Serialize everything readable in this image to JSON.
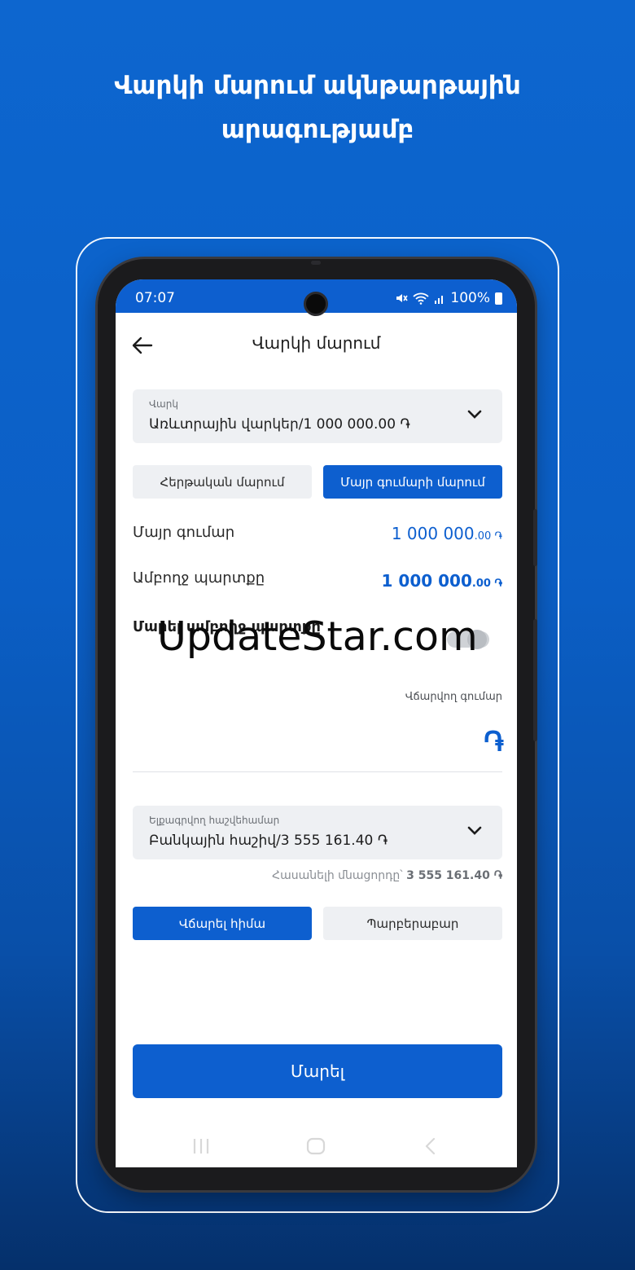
{
  "promo": {
    "title_line1": "Վարկի մարում ակնթարթային",
    "title_line2": "արագությամբ"
  },
  "status_bar": {
    "time": "07:07",
    "battery": "100%"
  },
  "app_bar": {
    "title": "Վարկի մարում"
  },
  "loan_select": {
    "caption": "Վարկ",
    "value": "Առևտրային վարկեր/1 000 000.00 ֏"
  },
  "repay_mode": {
    "regular_label": "Հերթական մարում",
    "principal_label": "Մայր գումարի մարում",
    "selected": "principal"
  },
  "summary": {
    "principal_label": "Մայր գումար",
    "principal_amount": "1 000 000",
    "principal_decimals": ".00 ֏",
    "total_debt_label": "Ամբողջ պարտքը",
    "total_debt_amount": "1 000 000",
    "total_debt_decimals": ".00 ֏"
  },
  "full_debt_toggle": {
    "label": "Մարել ամբողջ պարտքը",
    "on": false
  },
  "amount_field": {
    "caption": "Վճարվող գումար",
    "currency_symbol": "֏"
  },
  "account_select": {
    "caption": "Ելքագրվող հաշվեհամար",
    "value": "Բանկային հաշիվ/3 555 161.40 ֏"
  },
  "balance": {
    "label": "Հասանելի մնացորդը՝",
    "amount": "3 555 161.40 ֏"
  },
  "timing": {
    "now_label": "Վճարել հիմա",
    "periodic_label": "Պարբերաբար",
    "selected": "now"
  },
  "primary_action": {
    "label": "Մարել"
  },
  "watermark": {
    "text": "UpdateStar.com"
  },
  "colors": {
    "brand_blue": "#0d5fcf",
    "background_top": "#0d66cf",
    "background_bottom": "#05306b"
  }
}
